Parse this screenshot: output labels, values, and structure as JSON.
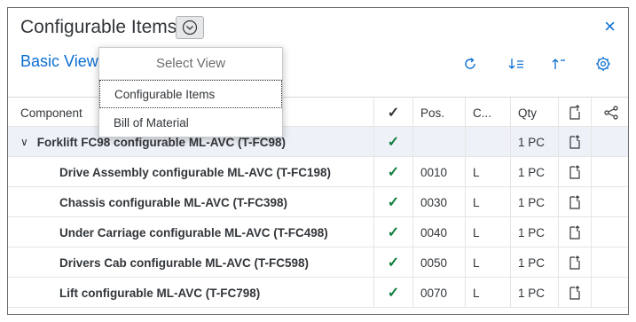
{
  "header": {
    "title": "Configurable Items",
    "close_label": "×"
  },
  "toolbar": {
    "view_label": "Basic View"
  },
  "popover": {
    "title": "Select View",
    "items": [
      {
        "label": "Configurable Items",
        "focused": true
      },
      {
        "label": "Bill of Material",
        "focused": false
      }
    ]
  },
  "table": {
    "columns": {
      "component": "Component",
      "position": "Pos.",
      "category": "C...",
      "quantity": "Qty"
    },
    "group": {
      "expander": "∨",
      "label": "Forklift FC98 configurable ML-AVC (T-FC98)",
      "position": "",
      "category": "",
      "quantity": "1 PC"
    },
    "rows": [
      {
        "label": "Drive Assembly configurable ML-AVC (T-FC198)",
        "position": "0010",
        "category": "L",
        "quantity": "1 PC"
      },
      {
        "label": "Chassis configurable ML-AVC (T-FC398)",
        "position": "0030",
        "category": "L",
        "quantity": "1 PC"
      },
      {
        "label": "Under Carriage configurable ML-AVC (T-FC498)",
        "position": "0040",
        "category": "L",
        "quantity": "1 PC"
      },
      {
        "label": "Drivers Cab configurable ML-AVC (T-FC598)",
        "position": "0050",
        "category": "L",
        "quantity": "1 PC"
      },
      {
        "label": "Lift configurable ML-AVC (T-FC798)",
        "position": "0070",
        "category": "L",
        "quantity": "1 PC"
      }
    ],
    "check_glyph": "✓"
  },
  "colors": {
    "accent": "#0a6ed1",
    "check": "#107e3e",
    "group_row_bg": "#eef2f8"
  },
  "icons": [
    "chevron-down-icon",
    "close-icon",
    "refresh-icon",
    "sort-descending-icon",
    "sort-ascending-icon",
    "settings-icon",
    "document-upload-icon",
    "share-icon"
  ]
}
